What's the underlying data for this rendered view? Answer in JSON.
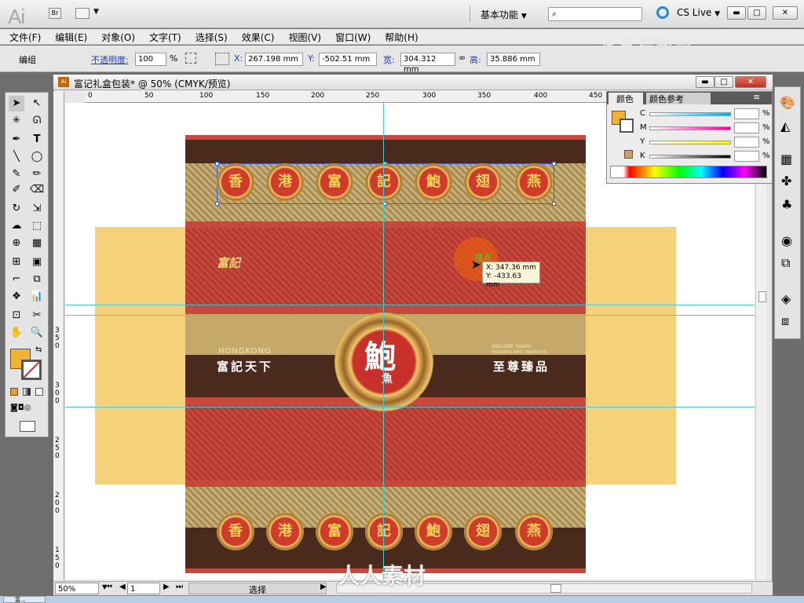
{
  "app": {
    "logo": "Ai",
    "bridge": "Br",
    "workspace": "基本功能",
    "cs_live": "CS Live"
  },
  "menu": [
    "文件(F)",
    "编辑(E)",
    "对象(O)",
    "文字(T)",
    "选择(S)",
    "效果(C)",
    "视图(V)",
    "窗口(W)",
    "帮助(H)"
  ],
  "control": {
    "group_label": "编组",
    "opacity_label": "不透明度:",
    "opacity_value": "100",
    "opacity_unit": "%",
    "x_label": "X:",
    "x_value": "267.198 mm",
    "y_label": "Y:",
    "y_value": "-502.51 mm",
    "w_label": "宽:",
    "w_value": "304.312 mm",
    "h_label": "高:",
    "h_value": "35.886 mm"
  },
  "watermark": {
    "line1": "水晶石教育",
    "line2": "CRYSTAL EDUCATION"
  },
  "document": {
    "title": "富记礼盒包装* @ 50% (CMYK/预览)"
  },
  "ruler": {
    "h_ticks": [
      "0",
      "50",
      "100",
      "150",
      "200",
      "250",
      "300",
      "350",
      "400",
      "450"
    ],
    "v_ticks": [
      "3 5 0",
      "3 0 0",
      "2 5 0",
      "2 0 0",
      "1 5 0"
    ]
  },
  "tooltip": {
    "anchor": "锚点",
    "x": "X: 347.36 mm",
    "y": "Y: -433.63 mm"
  },
  "artwork": {
    "top_chars": [
      "香",
      "港",
      "富",
      "記",
      "鮑",
      "翅",
      "燕"
    ],
    "bottom_chars": [
      "香",
      "港",
      "富",
      "記",
      "鮑",
      "翅",
      "燕"
    ],
    "brand": "富記",
    "left_en": "HONGKONG",
    "left_cn": "富記天下",
    "right_en_1": "ABALONE SHARK",
    "right_en_2": "FIN BIRD'S NEST PRODUCTS",
    "right_cn": "至尊臻品",
    "emblem": "鮑",
    "emblem_sub": "魚"
  },
  "color_panel": {
    "tabs": [
      "颜色",
      "颜色参考"
    ],
    "channels": [
      "C",
      "M",
      "Y",
      "K"
    ],
    "unit": "%"
  },
  "status": {
    "zoom": "50%",
    "page": "1",
    "mode": "选择"
  },
  "footer_watermark": "人人素材",
  "taskbar": {
    "item": "富..."
  },
  "colors": {
    "fill": "#f2b233",
    "guide": "#45c7dd",
    "brown": "#4a2a1c",
    "red": "#c8483c",
    "gold": "#f5d27a"
  }
}
